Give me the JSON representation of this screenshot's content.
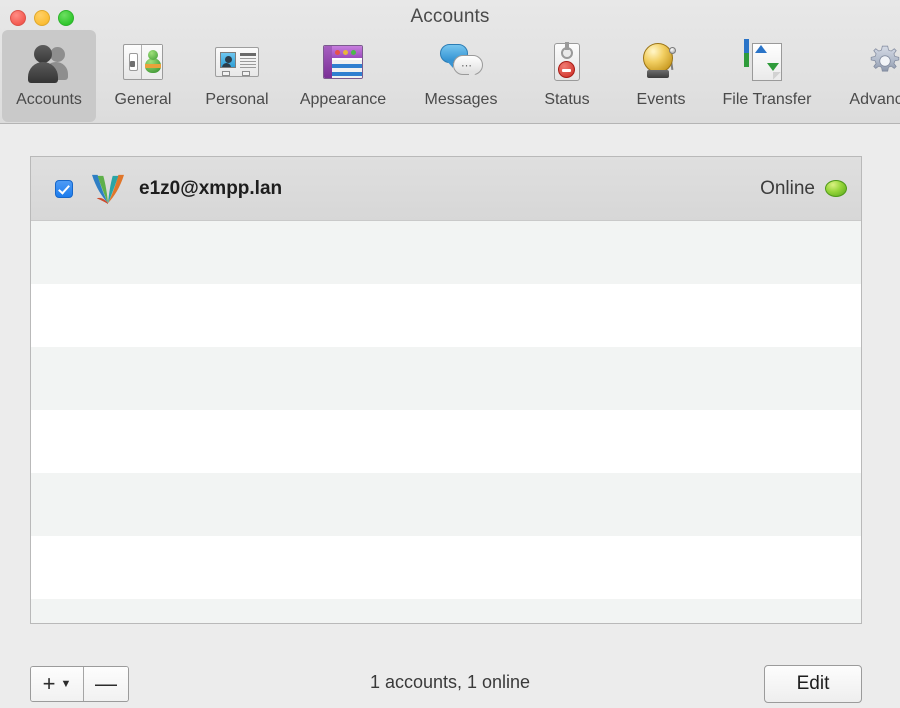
{
  "window": {
    "title": "Accounts",
    "traffic_lights": [
      "close",
      "minimize",
      "zoom"
    ]
  },
  "toolbar": {
    "items": [
      {
        "label": "Accounts",
        "icon": "accounts-icon",
        "selected": true
      },
      {
        "label": "General",
        "icon": "general-icon",
        "selected": false
      },
      {
        "label": "Personal",
        "icon": "personal-icon",
        "selected": false
      },
      {
        "label": "Appearance",
        "icon": "appearance-icon",
        "selected": false
      },
      {
        "label": "Messages",
        "icon": "messages-icon",
        "selected": false
      },
      {
        "label": "Status",
        "icon": "status-icon",
        "selected": false
      },
      {
        "label": "Events",
        "icon": "events-icon",
        "selected": false
      },
      {
        "label": "File Transfer",
        "icon": "file-transfer-icon",
        "selected": false
      },
      {
        "label": "Advanced",
        "icon": "advanced-icon",
        "selected": false
      }
    ]
  },
  "accounts_list": {
    "rows": [
      {
        "enabled": true,
        "logo": "xmpp-account-logo",
        "name": "e1z0@xmpp.lan",
        "status": "Online",
        "status_color": "#8fd02f"
      }
    ],
    "empty_rows": 7
  },
  "footer": {
    "add_label": "+",
    "add_menu_indicator": "⌄",
    "remove_label": "—",
    "summary": "1 accounts, 1 online",
    "edit_label": "Edit"
  },
  "colors": {
    "titlebar": "#e2e2e2",
    "selected_tab": "#c9c9c9",
    "content_bg": "#ececec",
    "row_selected": "#dbdbdb",
    "row_alt": "#f2f4f3",
    "checkbox_blue": "#1c7ced",
    "online_green": "#8fd02f"
  }
}
